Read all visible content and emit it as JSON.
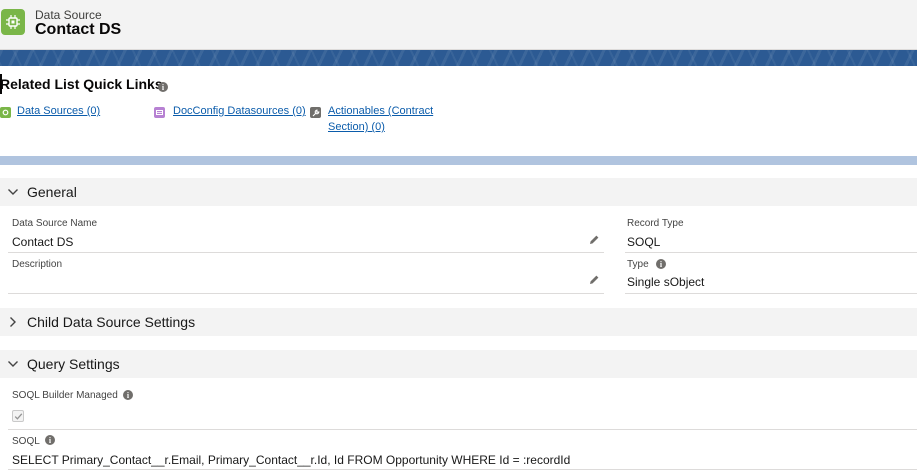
{
  "header": {
    "object_label": "Data Source",
    "record_title": "Contact DS",
    "icon": "datasource-chip-icon"
  },
  "quick_links": {
    "title": "Related List Quick Links",
    "links": [
      {
        "label": "Data Sources (0)",
        "icon": "datasource-icon",
        "color": "#7ab648"
      },
      {
        "label": "DocConfig Datasources (0)",
        "icon": "docconfig-icon",
        "color": "#b781d3"
      },
      {
        "label_line1": "Actionables (Contract",
        "label_line2": "Section) (0)",
        "icon": "wrench-icon",
        "color": "#706e6b"
      }
    ]
  },
  "sections": {
    "general": "General",
    "child": "Child Data Source Settings",
    "query": "Query Settings"
  },
  "general": {
    "name_label": "Data Source Name",
    "name_value": "Contact DS",
    "description_label": "Description",
    "description_value": "",
    "record_type_label": "Record Type",
    "record_type_value": "SOQL",
    "type_label": "Type",
    "type_value": "Single sObject"
  },
  "query": {
    "builder_label": "SOQL Builder Managed",
    "builder_checked": true,
    "soql_label": "SOQL",
    "soql_value": "SELECT Primary_Contact__r.Email, Primary_Contact__r.Id, Id FROM Opportunity WHERE Id = :recordId"
  },
  "colors": {
    "brand_band": "#2c5a93",
    "link": "#0b5cab",
    "section_bg": "#f3f3f3"
  }
}
